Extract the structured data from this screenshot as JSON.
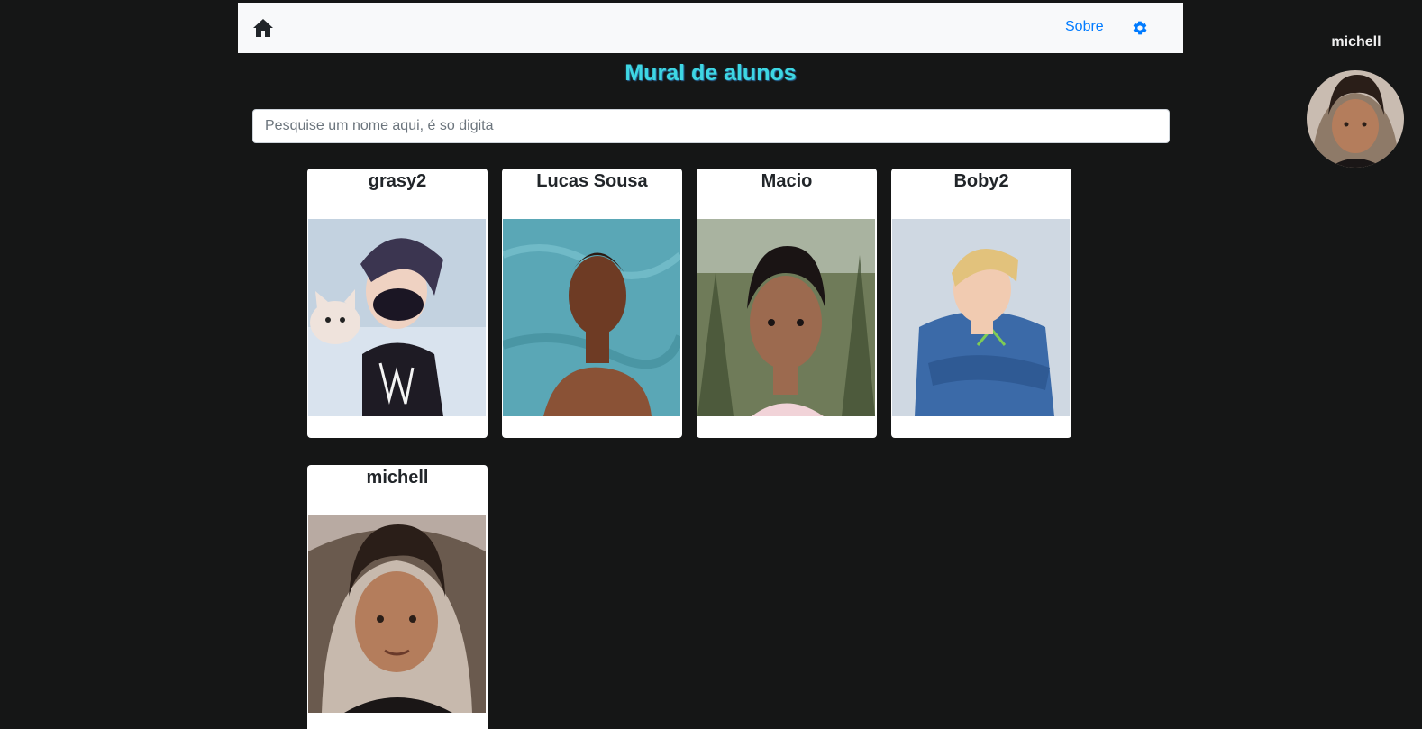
{
  "navbar": {
    "home_icon": "home-icon",
    "about_label": "Sobre",
    "settings_icon": "gear-icon",
    "link_color": "#007bff"
  },
  "title": "Mural de alunos",
  "title_color": "#3ed7e3",
  "search": {
    "placeholder": "Pesquise um nome aqui, é so digita",
    "value": ""
  },
  "students": [
    {
      "name": "grasy2"
    },
    {
      "name": "Lucas Sousa"
    },
    {
      "name": "Macio"
    },
    {
      "name": "Boby2"
    },
    {
      "name": "michell"
    }
  ],
  "profile": {
    "username": "michell"
  },
  "background_color": "#151616"
}
